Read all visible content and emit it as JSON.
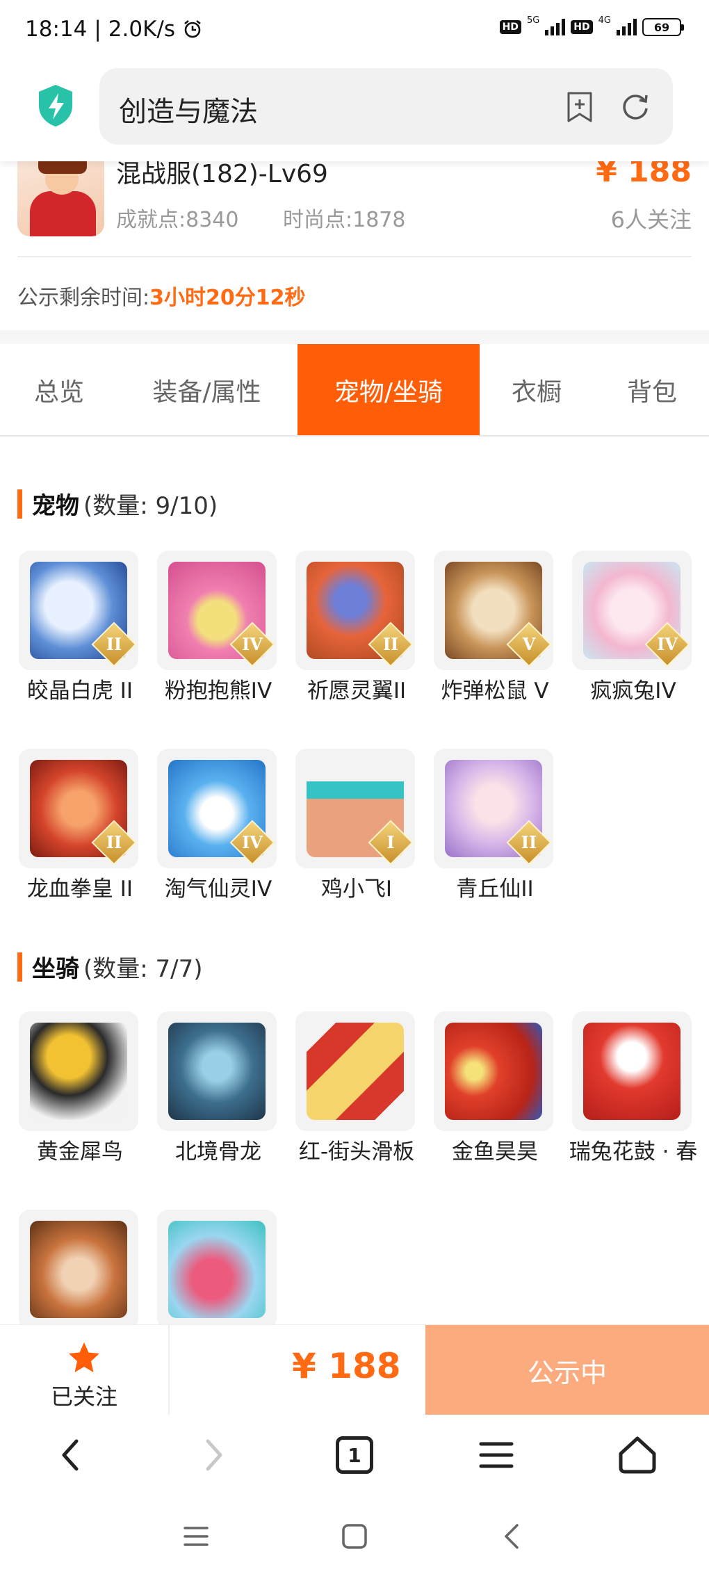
{
  "status_bar": {
    "time": "18:14",
    "speed": "2.0K/s",
    "net1": "5G",
    "net2": "4G",
    "hd": "HD",
    "battery": "69"
  },
  "browser": {
    "url_text": "创造与魔法"
  },
  "account": {
    "title": "混战服(182)-Lv69",
    "price": "¥ 188",
    "achievement": "成就点:8340",
    "fashion": "时尚点:1878",
    "watchers": "6人关注",
    "timer_label": "公示剩余时间:",
    "timer_value": "3小时20分12秒"
  },
  "tabs": [
    "总览",
    "装备/属性",
    "宠物/坐骑",
    "衣橱",
    "背包"
  ],
  "active_tab": "宠物/坐骑",
  "pets": {
    "name": "宠物",
    "count": "(数量: 9/10)",
    "items": [
      {
        "name": "皎晶白虎 II",
        "tier": "II"
      },
      {
        "name": "粉抱抱熊IV",
        "tier": "IV"
      },
      {
        "name": "祈愿灵翼II",
        "tier": "II"
      },
      {
        "name": "炸弹松鼠 V",
        "tier": "V"
      },
      {
        "name": "疯疯兔IV",
        "tier": "IV"
      },
      {
        "name": "龙血拳皇 II",
        "tier": "II"
      },
      {
        "name": "淘气仙灵IV",
        "tier": "IV"
      },
      {
        "name": "鸡小飞I",
        "tier": "I"
      },
      {
        "name": "青丘仙II",
        "tier": "II"
      }
    ]
  },
  "mounts": {
    "name": "坐骑",
    "count": "(数量: 7/7)",
    "items": [
      {
        "name": "黄金犀鸟"
      },
      {
        "name": "北境骨龙"
      },
      {
        "name": "红-街头滑板"
      },
      {
        "name": "金鱼昊昊"
      },
      {
        "name": "瑞兔花鼓 · 春"
      },
      {
        "name": ""
      },
      {
        "name": ""
      }
    ]
  },
  "action_bar": {
    "follow_label": "已关注",
    "price": "¥ 188",
    "status_label": "公示中"
  },
  "browser_nav": {
    "tab_count": "1"
  },
  "colors": {
    "accent": "#ff6a13",
    "tab_active": "#ff5d08",
    "status_button": "#fcab7f"
  }
}
